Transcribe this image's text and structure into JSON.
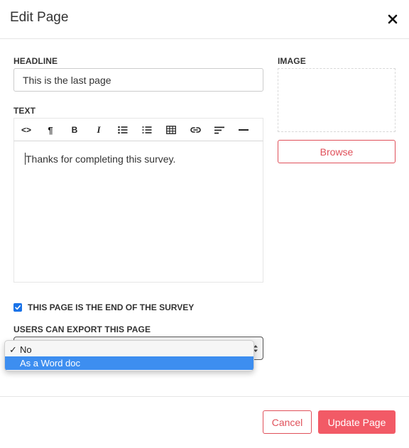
{
  "modal": {
    "title": "Edit Page",
    "close_icon": "close-icon"
  },
  "headline": {
    "label": "HEADLINE",
    "value": "This is the last page"
  },
  "text": {
    "label": "TEXT",
    "toolbar": [
      {
        "name": "code-view-icon",
        "glyph": "<>"
      },
      {
        "name": "paragraph-icon",
        "glyph": "¶"
      },
      {
        "name": "bold-icon",
        "glyph": "B"
      },
      {
        "name": "italic-icon",
        "glyph": "I"
      },
      {
        "name": "bullet-list-icon",
        "glyph": ""
      },
      {
        "name": "numbered-list-icon",
        "glyph": ""
      },
      {
        "name": "table-icon",
        "glyph": ""
      },
      {
        "name": "link-icon",
        "glyph": ""
      },
      {
        "name": "align-icon",
        "glyph": ""
      },
      {
        "name": "horizontal-rule-icon",
        "glyph": ""
      }
    ],
    "content": "Thanks for completing this survey."
  },
  "image": {
    "label": "IMAGE",
    "browse_label": "Browse"
  },
  "end_of_survey": {
    "checked": true,
    "label": "THIS PAGE IS THE END OF THE SURVEY"
  },
  "export": {
    "label": "USERS CAN EXPORT THIS PAGE",
    "options": [
      {
        "label": "No",
        "selected": true,
        "check": "✓"
      },
      {
        "label": "As a Word doc",
        "selected": false,
        "highlighted": true
      }
    ]
  },
  "footer": {
    "cancel_label": "Cancel",
    "update_label": "Update Page"
  },
  "colors": {
    "accent": "#e0505a",
    "primary_button": "#f25a66",
    "checkbox": "#1a73e8",
    "dropdown_highlight": "#3d8ef0"
  }
}
